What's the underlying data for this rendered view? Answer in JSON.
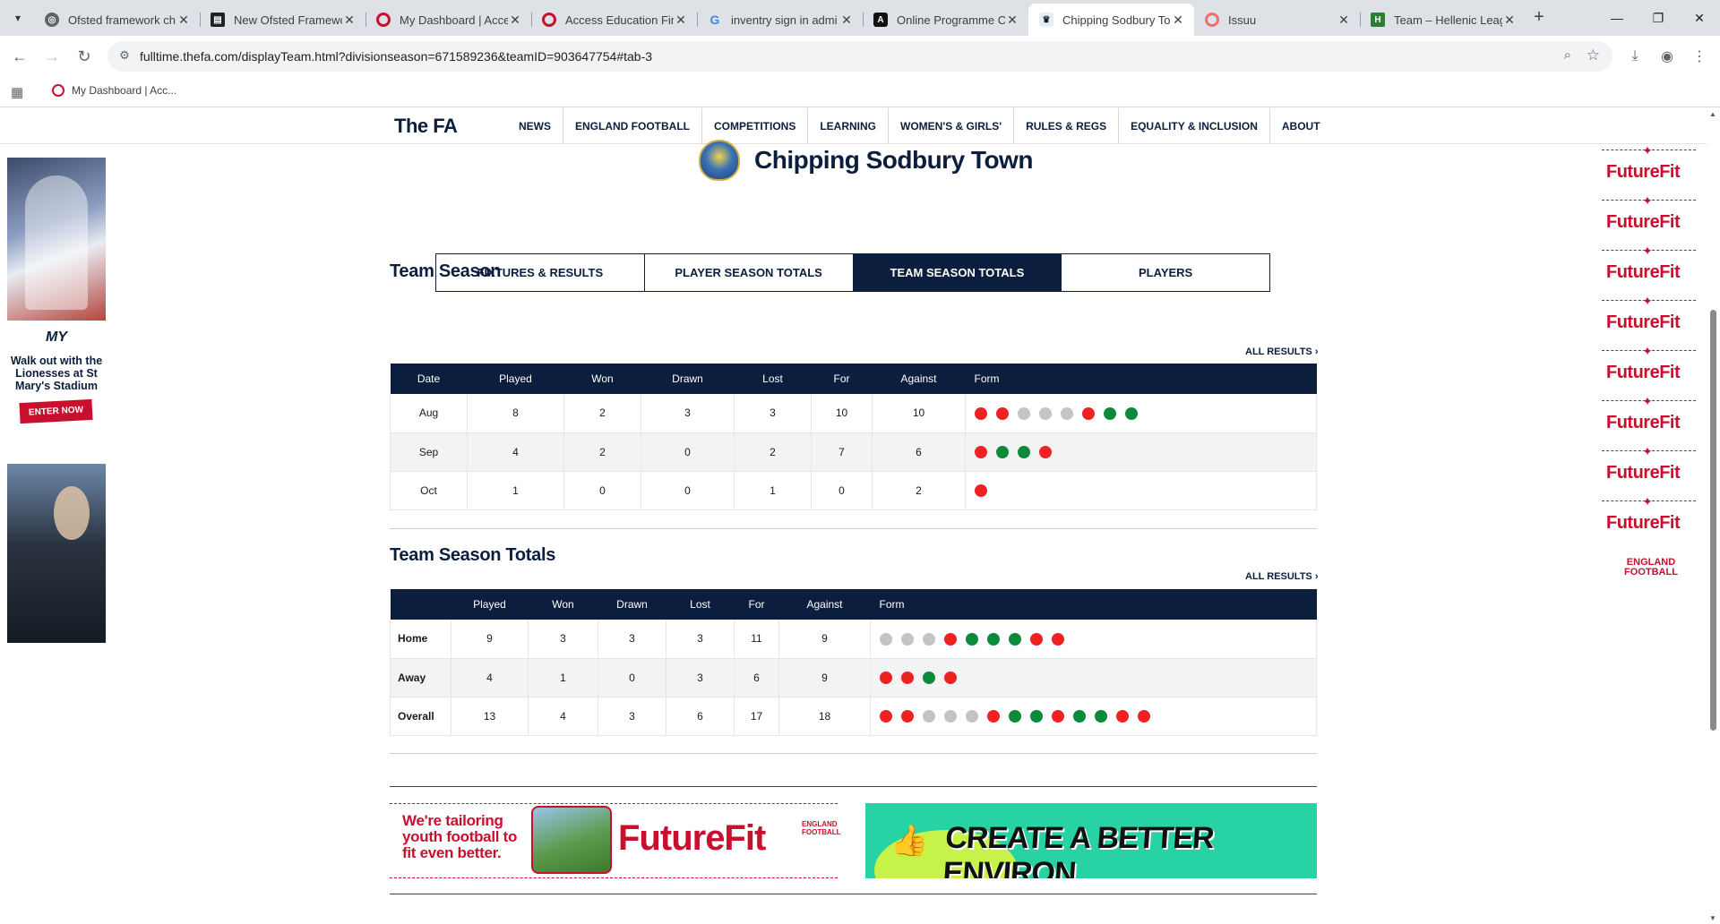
{
  "browser": {
    "tabs": [
      {
        "title": "Ofsted framework ch",
        "favicon": "globe-icon",
        "active": false
      },
      {
        "title": "New Ofsted Framewo",
        "favicon": "doc-icon",
        "active": false
      },
      {
        "title": "My Dashboard | Acce",
        "favicon": "ring-icon",
        "active": false
      },
      {
        "title": "Access Education Fin",
        "favicon": "ring-icon",
        "active": false
      },
      {
        "title": "inventry sign in admi",
        "favicon": "google-icon",
        "active": false
      },
      {
        "title": "Online Programme C",
        "favicon": "a-icon",
        "active": false
      },
      {
        "title": "Chipping Sodbury To",
        "favicon": "fa-icon",
        "active": true
      },
      {
        "title": "Issuu",
        "favicon": "issuu-icon",
        "active": false
      },
      {
        "title": "Team – Hellenic Leag",
        "favicon": "hellenic-icon",
        "active": false
      }
    ],
    "url": "fulltime.thefa.com/displayTeam.html?divisionseason=671589236&teamID=903647754#tab-3",
    "bookmark": "My Dashboard | Acc..."
  },
  "site": {
    "logo": "The FA",
    "nav": [
      "NEWS",
      "ENGLAND FOOTBALL",
      "COMPETITIONS",
      "LEARNING",
      "WOMEN'S & GIRLS'",
      "RULES & REGS",
      "EQUALITY & INCLUSION",
      "ABOUT"
    ]
  },
  "ad_left": {
    "brand": "MY",
    "headline": "Walk out with the Lionesses at St Mary's Stadium",
    "cta": "ENTER NOW"
  },
  "ad_right": {
    "repeat_text": "FutureFit",
    "badge": "ENGLAND FOOTBALL"
  },
  "team": {
    "name": "Chipping Sodbury Town"
  },
  "tabs": [
    {
      "label": "FIXTURES & RESULTS",
      "selected": false
    },
    {
      "label": "PLAYER SEASON TOTALS",
      "selected": false
    },
    {
      "label": "TEAM SEASON TOTALS",
      "selected": true
    },
    {
      "label": "PLAYERS",
      "selected": false
    }
  ],
  "team_season": {
    "title": "Team Season",
    "all_results": "ALL RESULTS",
    "headers": [
      "Date",
      "Played",
      "Won",
      "Drawn",
      "Lost",
      "For",
      "Against",
      "Form"
    ],
    "rows": [
      {
        "date": "Aug",
        "played": "8",
        "won": "2",
        "drawn": "3",
        "lost": "3",
        "for": "10",
        "against": "10",
        "form": [
          "L",
          "L",
          "D",
          "D",
          "D",
          "L",
          "W",
          "W"
        ]
      },
      {
        "date": "Sep",
        "played": "4",
        "won": "2",
        "drawn": "0",
        "lost": "2",
        "for": "7",
        "against": "6",
        "form": [
          "L",
          "W",
          "W",
          "L"
        ]
      },
      {
        "date": "Oct",
        "played": "1",
        "won": "0",
        "drawn": "0",
        "lost": "1",
        "for": "0",
        "against": "2",
        "form": [
          "L"
        ]
      }
    ]
  },
  "team_totals": {
    "title": "Team Season Totals",
    "all_results": "ALL RESULTS",
    "headers": [
      "",
      "Played",
      "Won",
      "Drawn",
      "Lost",
      "For",
      "Against",
      "Form"
    ],
    "rows": [
      {
        "label": "Home",
        "played": "9",
        "won": "3",
        "drawn": "3",
        "lost": "3",
        "for": "11",
        "against": "9",
        "form": [
          "D",
          "D",
          "D",
          "L",
          "W",
          "W",
          "W",
          "L",
          "L"
        ]
      },
      {
        "label": "Away",
        "played": "4",
        "won": "1",
        "drawn": "0",
        "lost": "3",
        "for": "6",
        "against": "9",
        "form": [
          "L",
          "L",
          "W",
          "L"
        ]
      },
      {
        "label": "Overall",
        "played": "13",
        "won": "4",
        "drawn": "3",
        "lost": "6",
        "for": "17",
        "against": "18",
        "form": [
          "L",
          "L",
          "D",
          "D",
          "D",
          "L",
          "W",
          "W",
          "L",
          "W",
          "W",
          "L",
          "L"
        ]
      }
    ]
  },
  "banners": {
    "futurefit_tagline": "We're tailoring youth football to fit even better.",
    "futurefit_brand": "FutureFit",
    "futurefit_badge": "ENGLAND FOOTBALL",
    "create_slogan": "CREATE A BETTER ENVIRON"
  },
  "colors": {
    "navy": "#0b1e3d",
    "loss": "#ee2222",
    "win": "#0a8a3a",
    "draw": "#c4c4c4",
    "futurefit_red": "#c8102e"
  }
}
